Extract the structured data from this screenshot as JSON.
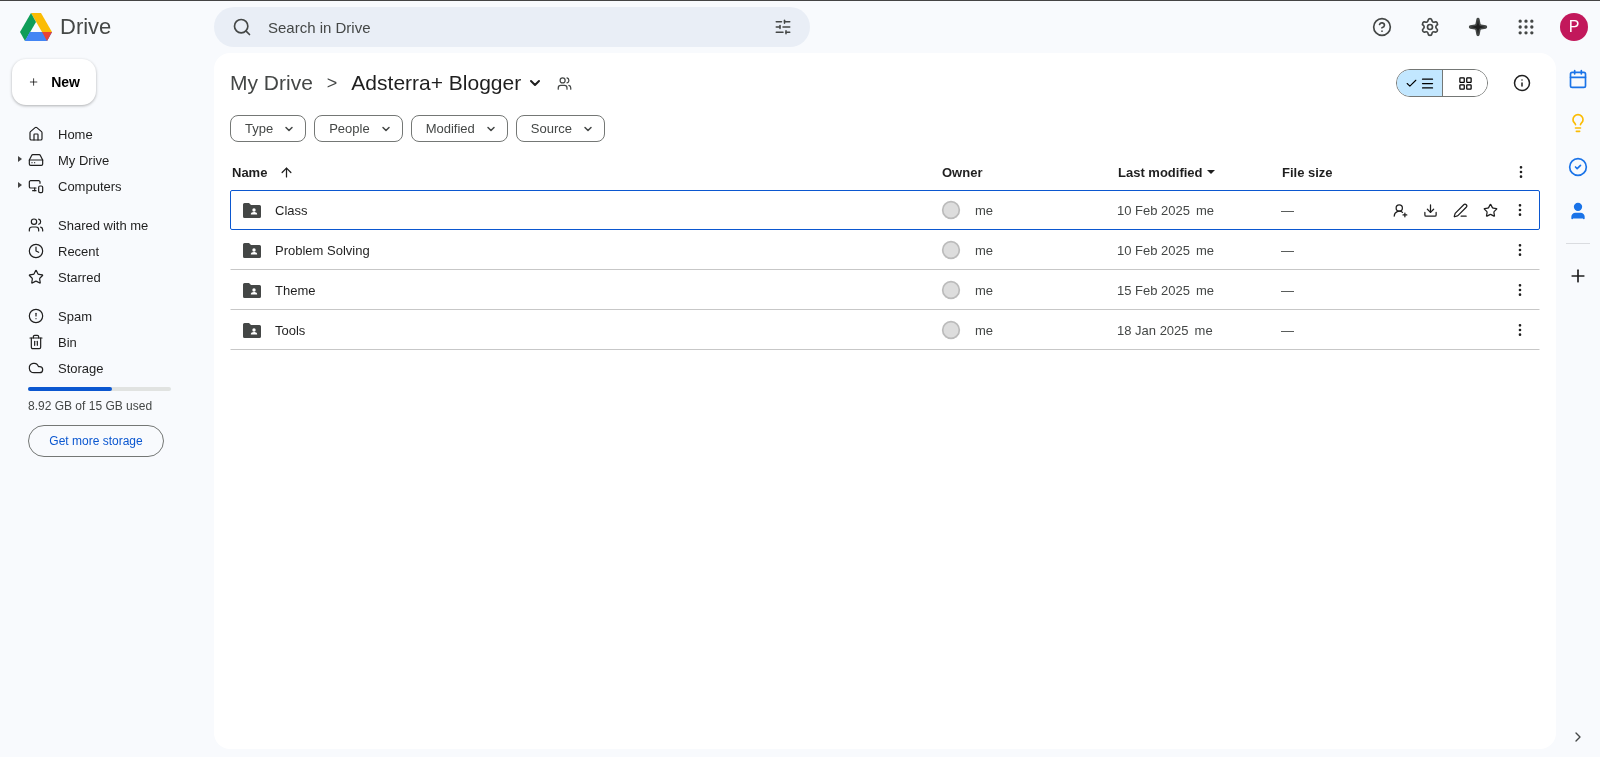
{
  "app": {
    "name": "Drive"
  },
  "search": {
    "placeholder": "Search in Drive"
  },
  "account": {
    "initial": "P",
    "color": "#c2185b"
  },
  "new_button": {
    "label": "New"
  },
  "sidebar": {
    "groups": [
      [
        {
          "kind": "home",
          "label": "Home",
          "expandable": false
        },
        {
          "kind": "mydrive",
          "label": "My Drive",
          "expandable": true
        },
        {
          "kind": "computers",
          "label": "Computers",
          "expandable": true
        }
      ],
      [
        {
          "kind": "shared",
          "label": "Shared with me",
          "expandable": false
        },
        {
          "kind": "recent",
          "label": "Recent",
          "expandable": false
        },
        {
          "kind": "starred",
          "label": "Starred",
          "expandable": false
        }
      ],
      [
        {
          "kind": "spam",
          "label": "Spam",
          "expandable": false
        },
        {
          "kind": "bin",
          "label": "Bin",
          "expandable": false
        },
        {
          "kind": "storage",
          "label": "Storage",
          "expandable": false
        }
      ]
    ]
  },
  "storage": {
    "level": 0.59,
    "text": "8.92 GB of 15 GB used",
    "button": "Get more storage"
  },
  "breadcrumb": {
    "parent": "My Drive",
    "separator": ">",
    "current": "Adsterra+ Blogger"
  },
  "view_toggle": [
    {
      "kind": "list",
      "selected": true
    },
    {
      "kind": "grid",
      "selected": false
    }
  ],
  "filters": [
    "Type",
    "People",
    "Modified",
    "Source"
  ],
  "table": {
    "columns": [
      {
        "label": "Name",
        "sorted": true,
        "descending": false
      },
      {
        "label": "Owner",
        "sorted": false
      },
      {
        "label": "Last modified",
        "sorted": true,
        "descending": true
      },
      {
        "label": "File size",
        "sorted": false
      }
    ],
    "rows": [
      {
        "name": "Class",
        "owner": "me",
        "modified_date": "10 Feb 2025",
        "modified_by": "me",
        "size": "—",
        "selected": true
      },
      {
        "name": "Problem Solving",
        "owner": "me",
        "modified_date": "10 Feb 2025",
        "modified_by": "me",
        "size": "—",
        "selected": false
      },
      {
        "name": "Theme",
        "owner": "me",
        "modified_date": "15 Feb 2025",
        "modified_by": "me",
        "size": "—",
        "selected": false
      },
      {
        "name": "Tools",
        "owner": "me",
        "modified_date": "18 Jan 2025",
        "modified_by": "me",
        "size": "—",
        "selected": false
      }
    ]
  },
  "side_apps": [
    {
      "kind": "calendar"
    },
    {
      "kind": "keep"
    },
    {
      "kind": "tasks"
    },
    {
      "kind": "contacts"
    }
  ]
}
